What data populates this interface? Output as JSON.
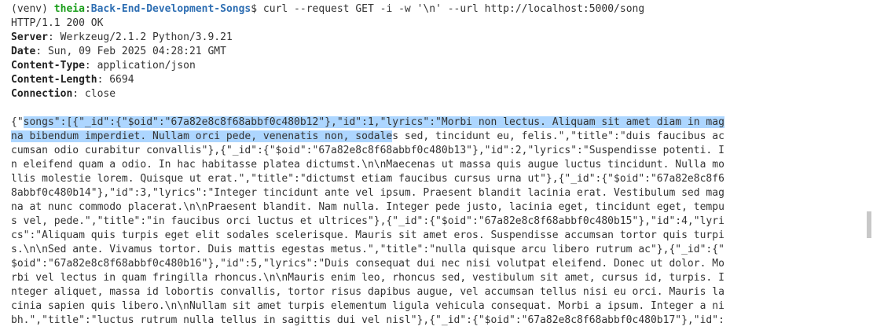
{
  "prompt": {
    "venv": "(venv) ",
    "host": "theia",
    "colon": ":",
    "path": "Back-End-Development-Songs",
    "symbol": "$ ",
    "command": "curl --request GET -i -w '\\n' --url http://localhost:5000/song"
  },
  "response": {
    "status": "HTTP/1.1 200 OK",
    "headers": [
      {
        "name": "Server",
        "value": ": Werkzeug/2.1.2 Python/3.9.21"
      },
      {
        "name": "Date",
        "value": ": Sun, 09 Feb 2025 04:28:21 GMT"
      },
      {
        "name": "Content-Type",
        "value": ": application/json"
      },
      {
        "name": "Content-Length",
        "value": ": 6694"
      },
      {
        "name": "Connection",
        "value": ": close"
      }
    ]
  },
  "body": {
    "line1_pre": "{\"",
    "line1_sel": "songs\":[{\"_id\":{\"$oid\":\"67a82e8c8f68abbf0c480b12\"},\"id\":1,\"lyrics\":\"Morbi non lectus. Aliquam sit amet diam in mag",
    "line2_sel": "na bibendum imperdiet. Nullam orci pede, venenatis non, sodale",
    "line2_post": "s sed, tincidunt eu, felis.\",\"title\":\"duis faucibus ac",
    "lines": [
      "cumsan odio curabitur convallis\"},{\"_id\":{\"$oid\":\"67a82e8c8f68abbf0c480b13\"},\"id\":2,\"lyrics\":\"Suspendisse potenti. I",
      "n eleifend quam a odio. In hac habitasse platea dictumst.\\n\\nMaecenas ut massa quis augue luctus tincidunt. Nulla mo",
      "llis molestie lorem. Quisque ut erat.\",\"title\":\"dictumst etiam faucibus cursus urna ut\"},{\"_id\":{\"$oid\":\"67a82e8c8f6",
      "8abbf0c480b14\"},\"id\":3,\"lyrics\":\"Integer tincidunt ante vel ipsum. Praesent blandit lacinia erat. Vestibulum sed mag",
      "na at nunc commodo placerat.\\n\\nPraesent blandit. Nam nulla. Integer pede justo, lacinia eget, tincidunt eget, tempu",
      "s vel, pede.\",\"title\":\"in faucibus orci luctus et ultrices\"},{\"_id\":{\"$oid\":\"67a82e8c8f68abbf0c480b15\"},\"id\":4,\"lyri",
      "cs\":\"Aliquam quis turpis eget elit sodales scelerisque. Mauris sit amet eros. Suspendisse accumsan tortor quis turpi",
      "s.\\n\\nSed ante. Vivamus tortor. Duis mattis egestas metus.\",\"title\":\"nulla quisque arcu libero rutrum ac\"},{\"_id\":{\"",
      "$oid\":\"67a82e8c8f68abbf0c480b16\"},\"id\":5,\"lyrics\":\"Duis consequat dui nec nisi volutpat eleifend. Donec ut dolor. Mo",
      "rbi vel lectus in quam fringilla rhoncus.\\n\\nMauris enim leo, rhoncus sed, vestibulum sit amet, cursus id, turpis. I",
      "nteger aliquet, massa id lobortis convallis, tortor risus dapibus augue, vel accumsan tellus nisi eu orci. Mauris la",
      "cinia sapien quis libero.\\n\\nNullam sit amet turpis elementum ligula vehicula consequat. Morbi a ipsum. Integer a ni",
      "bh.\",\"title\":\"luctus rutrum nulla tellus in sagittis dui vel nisl\"},{\"_id\":{\"$oid\":\"67a82e8c8f68abbf0c480b17\"},\"id\":"
    ]
  }
}
